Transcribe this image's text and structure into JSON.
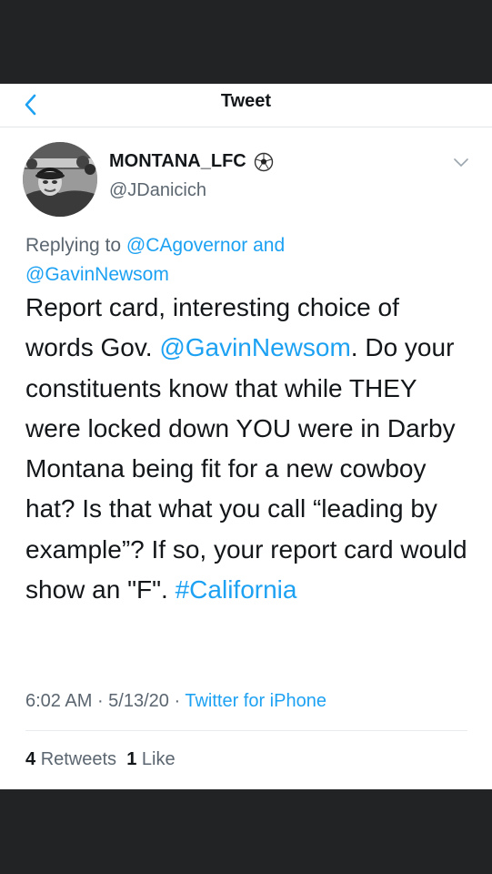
{
  "nav": {
    "title": "Tweet",
    "back_icon": "chevron-left-icon"
  },
  "tweet": {
    "display_name": "MONTANA_LFC",
    "name_emoji_icon": "soccer-ball-icon",
    "handle": "@JDanicich",
    "menu_icon": "chevron-down-icon",
    "reply_prefix": "Replying to ",
    "reply_to_1": "@CAgovernor",
    "reply_and": " and",
    "reply_to_2": "@GavinNewsom",
    "text_part1": "Report card, interesting choice of words Gov. ",
    "mention": "@GavinNewsom",
    "text_part2": ". Do your constituents know that while THEY were locked down YOU were in Darby Montana being fit for a new cowboy hat? Is that what you call “leading by example”? If so, your report card would show an \"F\". ",
    "hashtag": "#California",
    "time": "6:02 AM",
    "date": "5/13/20",
    "source": "Twitter for iPhone",
    "retweets_count": "4",
    "retweets_label": "Retweets",
    "likes_count": "1",
    "likes_label": "Like"
  },
  "colors": {
    "accent": "#1da1f2",
    "text": "#14171a",
    "secondary": "#5b6670",
    "border": "#e6ecf0"
  }
}
